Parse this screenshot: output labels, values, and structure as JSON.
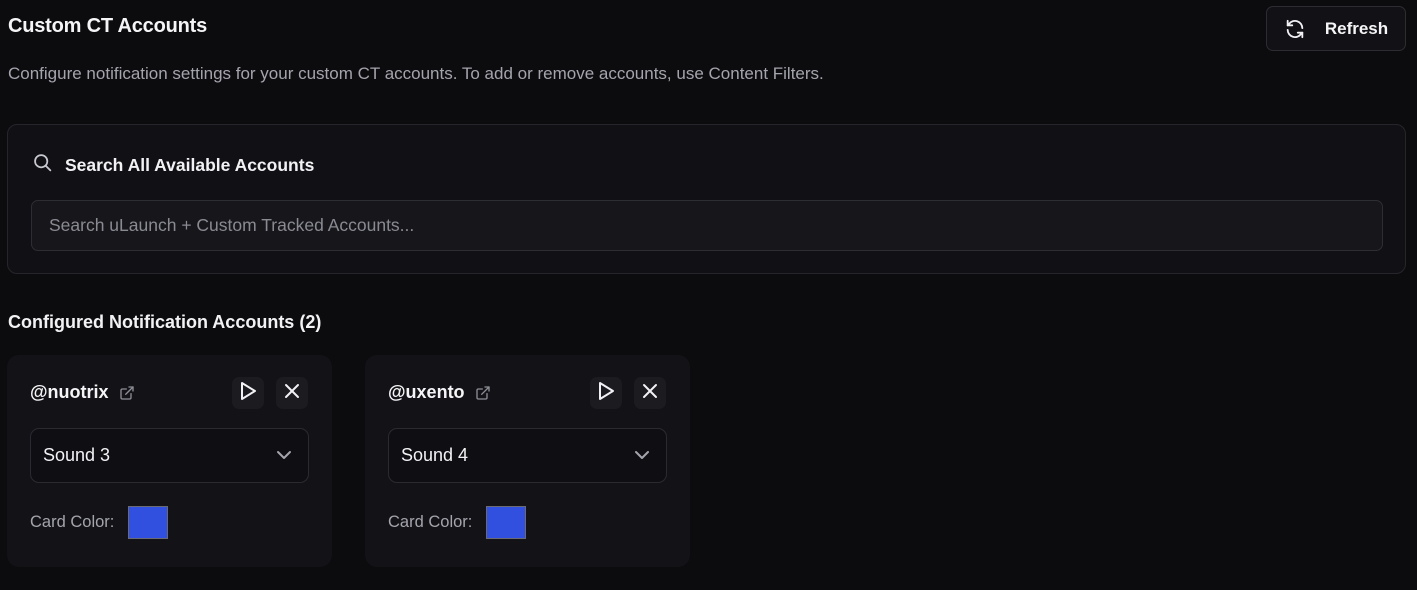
{
  "header": {
    "title": "Custom CT Accounts",
    "description": "Configure notification settings for your custom CT accounts. To add or remove accounts, use Content Filters.",
    "refresh_label": "Refresh",
    "refresh_icon": "refresh-icon"
  },
  "search": {
    "heading": "Search All Available Accounts",
    "icon": "search-icon",
    "value": "",
    "placeholder": "Search uLaunch + Custom Tracked Accounts..."
  },
  "configured": {
    "title": "Configured Notification Accounts (2)",
    "accounts": [
      {
        "handle": "@nuotrix",
        "sound": "Sound 3",
        "card_color_label": "Card Color:",
        "card_color": "#3150e0"
      },
      {
        "handle": "@uxento",
        "sound": "Sound 4",
        "card_color_label": "Card Color:",
        "card_color": "#3150e0"
      }
    ]
  },
  "colors": {
    "background": "#0c0c0f",
    "card": "#131317",
    "text": "#f2f2f5",
    "muted_text": "#a4a4ad"
  }
}
